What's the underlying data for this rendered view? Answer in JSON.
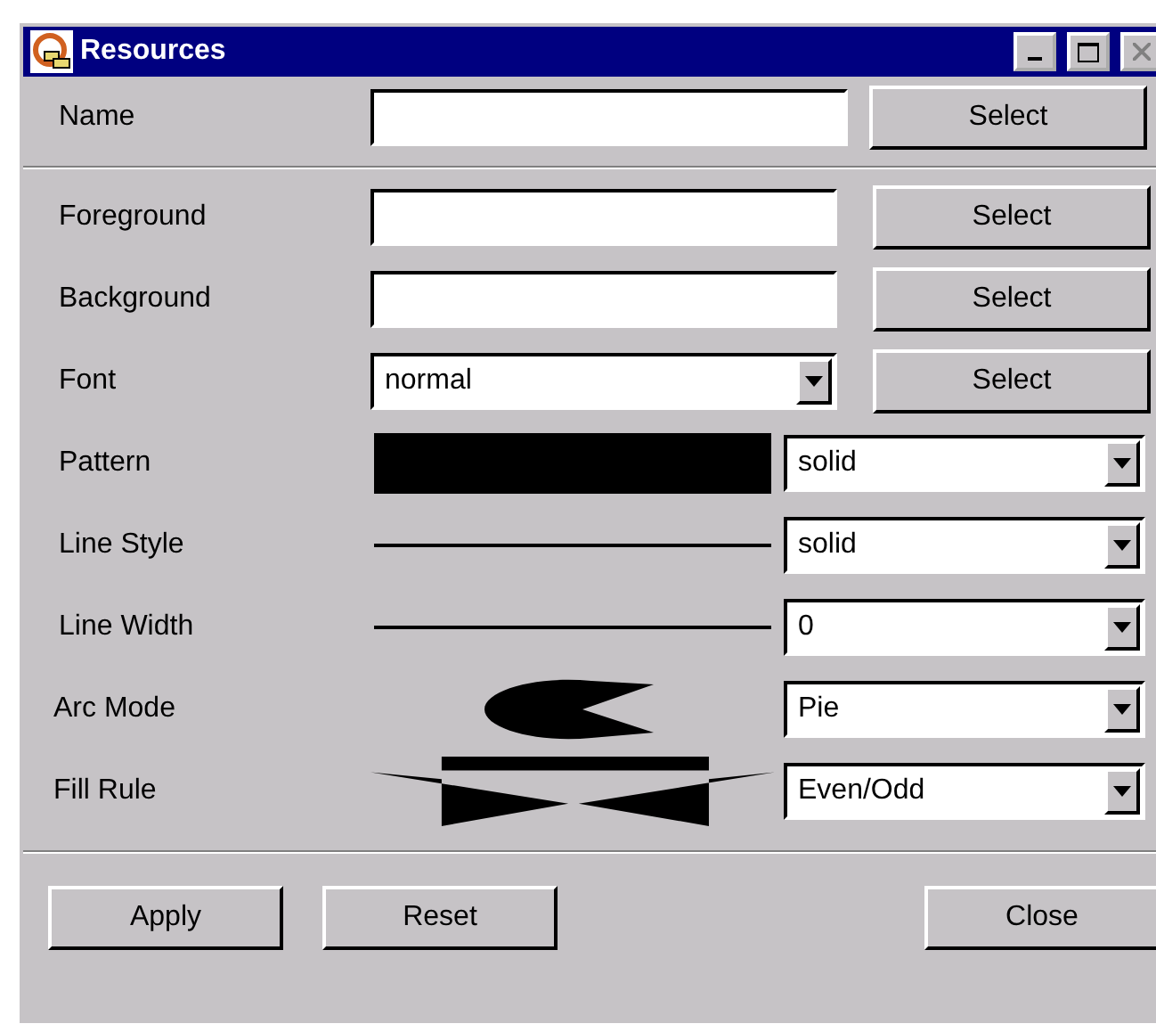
{
  "window": {
    "title": "Resources"
  },
  "name_row": {
    "label": "Name",
    "button": "Select"
  },
  "rows": [
    {
      "kind": "text",
      "label": "Foreground",
      "button": "Select"
    },
    {
      "kind": "text",
      "label": "Background",
      "button": "Select"
    },
    {
      "kind": "font",
      "label": "Font",
      "value": "normal",
      "button": "Select"
    },
    {
      "kind": "pattern",
      "label": "Pattern",
      "value": "solid"
    },
    {
      "kind": "line",
      "label": "Line Style",
      "value": "solid"
    },
    {
      "kind": "line",
      "label": "Line Width",
      "value": "0"
    },
    {
      "kind": "arc",
      "label": "Arc Mode",
      "value": "Pie"
    },
    {
      "kind": "fill",
      "label": "Fill Rule",
      "value": "Even/Odd"
    }
  ],
  "buttons": {
    "left": [
      "Apply",
      "Reset"
    ],
    "right": [
      "Close"
    ]
  }
}
